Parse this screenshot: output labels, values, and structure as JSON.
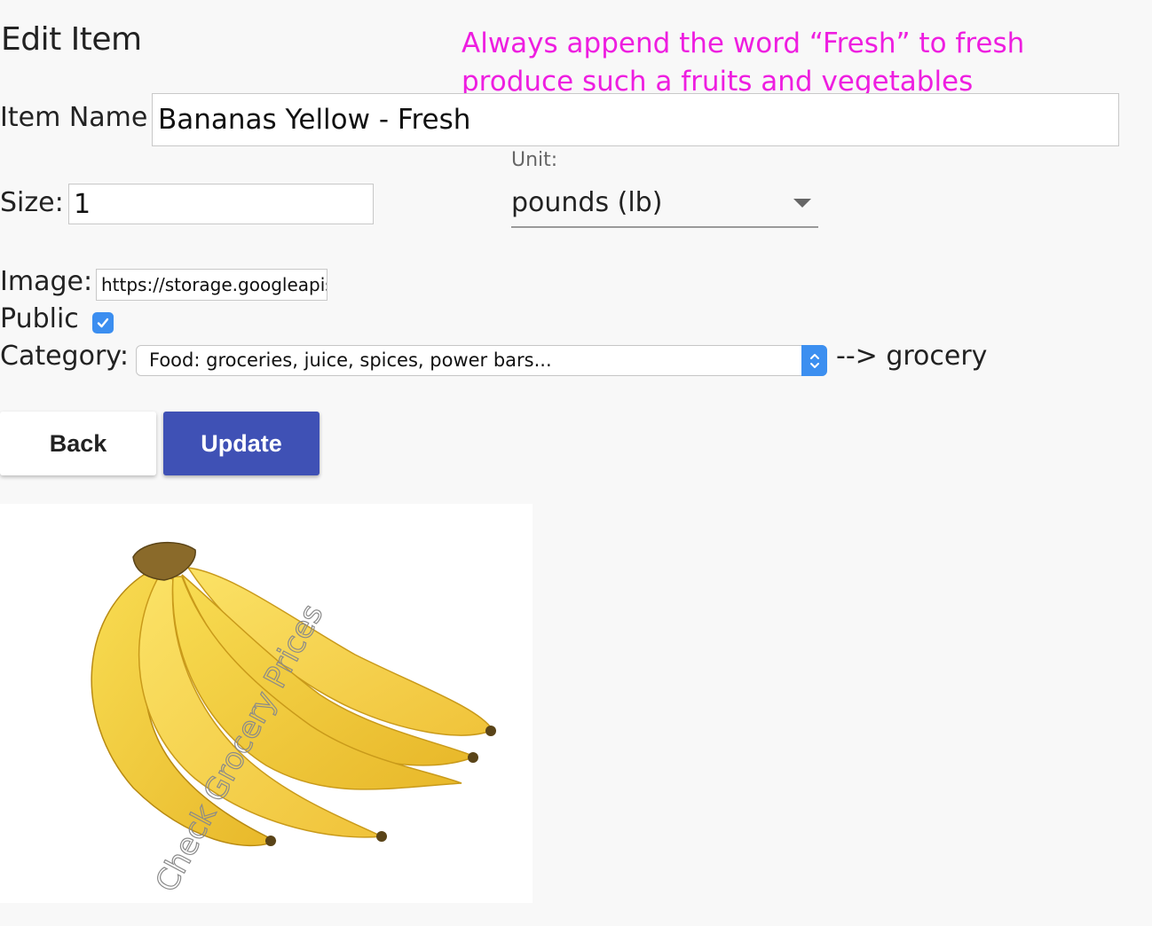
{
  "page": {
    "title": "Edit Item"
  },
  "annotation": {
    "note": "Always append the word “Fresh” to fresh produce such a fruits and vegetables",
    "color": "#ee1ee0"
  },
  "form": {
    "name_label": "Item Name",
    "name_value": "Bananas Yellow - Fresh",
    "size_label": "Size:",
    "size_value": "1",
    "unit_caption": "Unit:",
    "unit_value": "pounds (lb)",
    "image_label": "Image:",
    "image_value": "https://storage.googleapis",
    "public_label": "Public",
    "public_checked": true,
    "category_label": "Category:",
    "category_value": "Food: groceries, juice, spices, power bars...",
    "category_mapping": "--> grocery"
  },
  "buttons": {
    "back": "Back",
    "update": "Update",
    "update_color": "#3f51b5"
  },
  "image": {
    "watermark": "Check Grocery Prices",
    "subject": "banana-bunch"
  }
}
